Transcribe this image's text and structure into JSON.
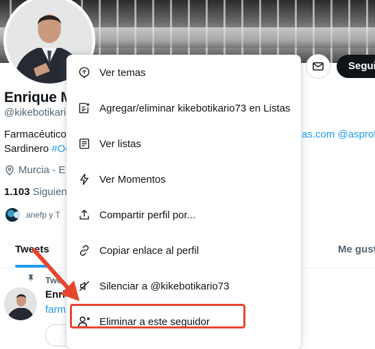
{
  "profile": {
    "name": "Enrique M",
    "handle": "@kikebotikario",
    "bio_line1": "Farmacéutico",
    "bio_line2_prefix": "Sardinero ",
    "bio_line2_hashtag": "#Oc",
    "bio_right": "as.com @asprof",
    "location": "Murcia - E",
    "following_count": "1.103",
    "following_label": " Siguien",
    "followed_by": "anefp y T"
  },
  "header": {
    "follow_label": "Segui"
  },
  "tabs": {
    "tweets": "Tweets",
    "likes": "Me gust"
  },
  "pinned_tweet": {
    "label": "Twe",
    "author": "Enric",
    "link": "farm"
  },
  "menu": {
    "items": [
      {
        "label": "Ver temas",
        "icon": "topics-icon"
      },
      {
        "label": "Agregar/eliminar kikebotikario73 en Listas",
        "icon": "list-add-icon"
      },
      {
        "label": "Ver listas",
        "icon": "list-icon"
      },
      {
        "label": "Ver Momentos",
        "icon": "lightning-icon"
      },
      {
        "label": "Compartir perfil por...",
        "icon": "share-icon"
      },
      {
        "label": "Copiar enlace al perfil",
        "icon": "link-icon"
      },
      {
        "label": "Silenciar a @kikebotikario73",
        "icon": "mute-icon"
      },
      {
        "label": "Eliminar a este seguidor",
        "icon": "remove-follower-icon"
      }
    ]
  },
  "colors": {
    "accent": "#1d9bf0",
    "text": "#0f1419",
    "muted": "#536471",
    "annotation": "#e8452f"
  }
}
